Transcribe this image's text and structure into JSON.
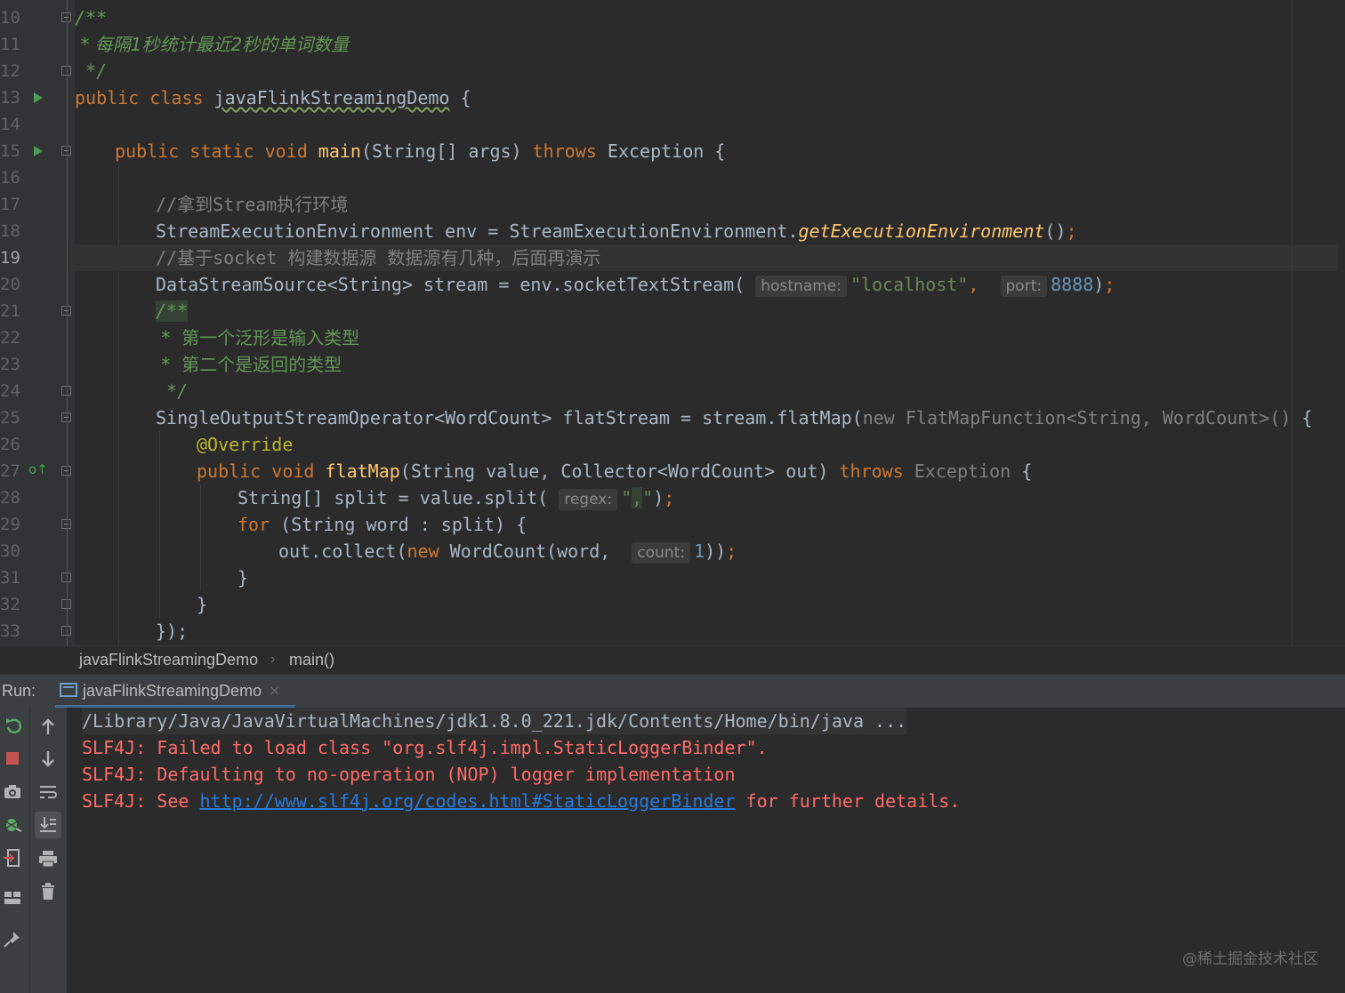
{
  "editor": {
    "line_numbers": [
      "10",
      "11",
      "12",
      "13",
      "14",
      "15",
      "16",
      "17",
      "18",
      "19",
      "20",
      "21",
      "22",
      "23",
      "24",
      "25",
      "26",
      "27",
      "28",
      "29",
      "30",
      "31",
      "32",
      "33"
    ],
    "current_line": "19",
    "lines": {
      "l10_doc": "/**",
      "l11_doc": " * 每隔1秒统计最近2秒的单词数量",
      "l12_doc": " */",
      "l13_kw": "public class ",
      "l13_name": "javaFlinkStreamingDemo",
      "l13_rest": " {",
      "l15_kw": "public static void ",
      "l15_fn": "main",
      "l15_args": "(String[] args) ",
      "l15_throws": "throws",
      "l15_rest": " Exception {",
      "l17_cm": "//拿到Stream执行环境",
      "l18_a": "StreamExecutionEnvironment env = StreamExecutionEnvironment.",
      "l18_it": "getExecutionEnvironment",
      "l18_b": "()",
      "l18_semi": ";",
      "l19_cm": "//基于socket 构建数据源 数据源有几种，后面再演示",
      "l20_a": "DataStreamSource<String> stream = env.socketTextStream( ",
      "l20_hint1": "hostname:",
      "l20_str": "\"localhost\"",
      "l20_comma": ",  ",
      "l20_hint2": "port:",
      "l20_num": "8888",
      "l20_b": ")",
      "l20_semi": ";",
      "l21_doc": "/**",
      "l22_doc": " *  第一个泛形是输入类型",
      "l23_doc": " *  第二个是返回的类型",
      "l24_doc": " */",
      "l25_a": "SingleOutputStreamOperator<WordCount> flatStream = stream.flatMap(",
      "l25_dim": "new FlatMapFunction<String, WordCount>()",
      "l25_b": " {",
      "l26_ann": "@Override",
      "l27_kw": "public void ",
      "l27_fn": "flatMap",
      "l27_args": "(String value, Collector<WordCount> out) ",
      "l27_throws": "throws",
      "l27_dim": " Exception",
      "l27_rest": " {",
      "l28_a": "String[] split = value.split( ",
      "l28_hint": "regex:",
      "l28_str1": "\"",
      "l28_comma": ",",
      "l28_str2": "\"",
      "l28_b": ")",
      "l28_semi": ";",
      "l29_kw": "for",
      "l29_rest": " (String word : split) {",
      "l30_a": "out.collect(",
      "l30_kw": "new",
      "l30_b": " WordCount(word,  ",
      "l30_hint": "count:",
      "l30_num": "1",
      "l30_c": "))",
      "l30_semi": ";",
      "l31": "}",
      "l32": "}",
      "l33": "});"
    }
  },
  "breadcrumb": {
    "class_name": "javaFlinkStreamingDemo",
    "separator": "›",
    "method": "main()"
  },
  "run_panel": {
    "label": "Run:",
    "tab_label": "javaFlinkStreamingDemo",
    "tab_close": "×",
    "toolbar_left": [
      "rerun-icon",
      "stop-icon",
      "camera-icon",
      "debug-icon",
      "exit-icon",
      "layout-icon",
      "pin-icon"
    ],
    "toolbar_right": [
      "up-arrow-icon",
      "down-arrow-icon",
      "soft-wrap-icon",
      "scroll-to-end-icon",
      "print-icon",
      "trash-icon"
    ],
    "console": {
      "line1": "/Library/Java/JavaVirtualMachines/jdk1.8.0_221.jdk/Contents/Home/bin/java ...",
      "line2": "SLF4J: Failed to load class \"org.slf4j.impl.StaticLoggerBinder\".",
      "line3": "SLF4J: Defaulting to no-operation (NOP) logger implementation",
      "line4_prefix": "SLF4J: See ",
      "line4_link": "http://www.slf4j.org/codes.html#StaticLoggerBinder",
      "line4_suffix": " for further details."
    }
  },
  "watermark": "@稀土掘金技术社区",
  "colors": {
    "background": "#2b2b2b",
    "keyword": "#cc7832",
    "function": "#ffc66d",
    "string": "#6a8759",
    "number": "#6897bb",
    "doc_comment": "#629755",
    "error_text": "#ff6b68",
    "link": "#287bde"
  }
}
